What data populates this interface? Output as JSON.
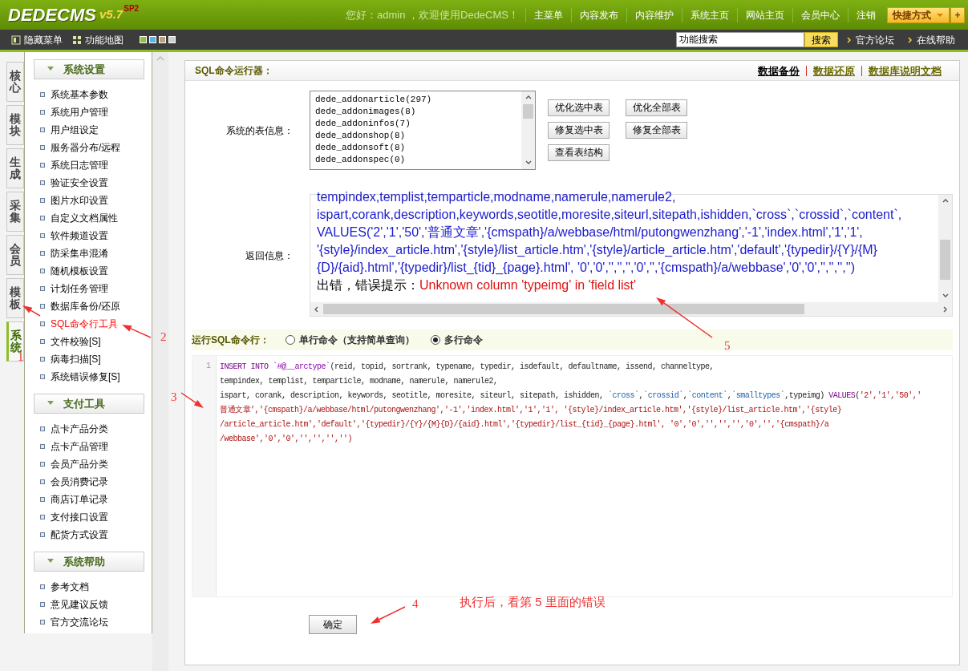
{
  "header": {
    "logo": "DEDECMS",
    "version": "v5.7",
    "edition": "SP2",
    "greeting": "您好：admin ，欢迎使用DedeCMS！",
    "nav": [
      "主菜单",
      "内容发布",
      "内容维护",
      "系统主页",
      "网站主页",
      "会员中心",
      "注销"
    ],
    "shortcut": "快捷方式",
    "add": "+"
  },
  "toolbar": {
    "links": [
      "隐藏菜单",
      "功能地图"
    ],
    "themes": [
      {
        "color": "#8cc43c"
      },
      {
        "color": "#5ab4e6"
      },
      {
        "color": "#b9a27c"
      },
      {
        "color": "#cfcfcf"
      }
    ],
    "search": {
      "value": "功能搜索",
      "button": "搜索"
    },
    "help_links": [
      "官方论坛",
      "在线帮助"
    ]
  },
  "side_tabs": [
    {
      "label": "核心",
      "selected": false
    },
    {
      "label": "模块",
      "selected": false
    },
    {
      "label": "生成",
      "selected": false
    },
    {
      "label": "采集",
      "selected": false
    },
    {
      "label": "会员",
      "selected": false
    },
    {
      "label": "模板",
      "selected": false
    },
    {
      "label": "系统",
      "selected": true
    }
  ],
  "menu_groups": [
    {
      "title": "系统设置",
      "expanded": true,
      "items": [
        {
          "label": "系统基本参数",
          "selected": false
        },
        {
          "label": "系统用户管理",
          "selected": false
        },
        {
          "label": "用户组设定",
          "selected": false
        },
        {
          "label": "服务器分布/远程",
          "selected": false
        },
        {
          "label": "系统日志管理",
          "selected": false
        },
        {
          "label": "验证安全设置",
          "selected": false
        },
        {
          "label": "图片水印设置",
          "selected": false
        },
        {
          "label": "自定义文档属性",
          "selected": false
        },
        {
          "label": "软件频道设置",
          "selected": false
        },
        {
          "label": "防采集串混淆",
          "selected": false
        },
        {
          "label": "随机模板设置",
          "selected": false
        },
        {
          "label": "计划任务管理",
          "selected": false
        },
        {
          "label": "数据库备份/还原",
          "selected": false
        },
        {
          "label": "SQL命令行工具",
          "selected": true
        },
        {
          "label": "文件校验[S]",
          "selected": false
        },
        {
          "label": "病毒扫描[S]",
          "selected": false
        },
        {
          "label": "系统错误修复[S]",
          "selected": false
        }
      ]
    },
    {
      "title": "支付工具",
      "expanded": true,
      "items": [
        {
          "label": "点卡产品分类",
          "selected": false
        },
        {
          "label": "点卡产品管理",
          "selected": false
        },
        {
          "label": "会员产品分类",
          "selected": false
        },
        {
          "label": "会员消费记录",
          "selected": false
        },
        {
          "label": "商店订单记录",
          "selected": false
        },
        {
          "label": "支付接口设置",
          "selected": false
        },
        {
          "label": "配货方式设置",
          "selected": false
        }
      ]
    },
    {
      "title": "系统帮助",
      "expanded": true,
      "items": [
        {
          "label": "参考文档",
          "selected": false
        },
        {
          "label": "意见建议反馈",
          "selected": false
        },
        {
          "label": "官方交流论坛",
          "selected": false
        }
      ]
    }
  ],
  "main": {
    "title": "SQL命令运行器：",
    "links": [
      {
        "label": "数据备份",
        "selected": true
      },
      {
        "label": "数据还原",
        "selected": false
      },
      {
        "label": "数据库说明文档",
        "selected": false
      }
    ],
    "tables": {
      "label": "系统的表信息：",
      "options": [
        "dede_addonarticle(297)",
        "dede_addonimages(8)",
        "dede_addoninfos(7)",
        "dede_addonshop(8)",
        "dede_addonsoft(8)",
        "dede_addonspec(0)"
      ]
    },
    "table_buttons": [
      "优化选中表",
      "优化全部表",
      "修复选中表",
      "修复全部表",
      "查看表结构"
    ],
    "return_info": {
      "label": "返回信息：",
      "lines": [
        "tempindex,templist,temparticle,modname,namerule,namerule2,",
        "ispart,corank,description,keywords,seotitle,moresite,siteurl,sitepath,ishidden,`cross`,`crossid`,`content`,",
        "VALUES('2','1','50','普通文章','{cmspath}/a/webbase/html/putongwenzhang','-1','index.html','1','1',",
        "'{style}/index_article.htm','{style}/list_article.htm','{style}/article_article.htm','default','{typedir}/{Y}/{M}",
        "{D}/{aid}.html','{typedir}/list_{tid}_{page}.html', '0','0','','','','0','','{cmspath}/a/webbase','0','0','','','','')"
      ],
      "message": "出错，错误提示：",
      "error": "Unknown column 'typeimg' in 'field list'"
    },
    "run": {
      "label": "运行SQL命令行：",
      "modes": [
        {
          "label": "单行命令（支持简单查询）",
          "selected": false
        },
        {
          "label": "多行命令",
          "selected": true
        }
      ]
    },
    "editor": {
      "line_numbers": [
        "1"
      ],
      "lines": [
        [
          {
            "kind": "keyword",
            "text": "INSERT INTO "
          },
          {
            "kind": "table",
            "text": "`#@__arctype`"
          },
          {
            "kind": "plain",
            "text": "(reid, topid, sortrank, typename, typedir, isdefault, defaultname, issend, channeltype,"
          }
        ],
        [
          {
            "kind": "plain",
            "text": "tempindex, templist, temparticle, modname, namerule, namerule2,"
          }
        ],
        [
          {
            "kind": "plain",
            "text": "ispart, corank, description, keywords, seotitle, moresite, siteurl, sitepath, ishidden, "
          },
          {
            "kind": "ident",
            "text": "`cross`"
          },
          {
            "kind": "plain",
            "text": ","
          },
          {
            "kind": "ident",
            "text": "`crossid`"
          },
          {
            "kind": "plain",
            "text": ","
          },
          {
            "kind": "ident",
            "text": "`content`"
          },
          {
            "kind": "plain",
            "text": ","
          },
          {
            "kind": "ident",
            "text": "`smalltypes`"
          },
          {
            "kind": "plain",
            "text": ",typeimg) "
          },
          {
            "kind": "keyword",
            "text": "VALUES"
          },
          {
            "kind": "plain",
            "text": "("
          },
          {
            "kind": "string",
            "text": "'2','1','50','"
          }
        ],
        [
          {
            "kind": "string",
            "text": "普通文章','{cmspath}/a/webbase/html/putongwenzhang','-1','index.html','1','1', '{style}/index_article.htm','{style}/list_article.htm','{style}"
          }
        ],
        [
          {
            "kind": "string",
            "text": "/article_article.htm','default','{typedir}/{Y}/{M}{D}/{aid}.html','{typedir}/list_{tid}_{page}.html', '0','0','','','','0','','{cmspath}/a"
          }
        ],
        [
          {
            "kind": "string",
            "text": "/webbase','0','0','','','','')"
          }
        ]
      ]
    },
    "submit": "确定"
  },
  "annotations": [
    {
      "kind": "marker",
      "label": "1"
    },
    {
      "kind": "marker",
      "label": "2"
    },
    {
      "kind": "marker",
      "label": "3"
    },
    {
      "kind": "marker",
      "label": "4"
    },
    {
      "kind": "marker",
      "label": "5"
    },
    {
      "kind": "note",
      "label": "执行后，看第 5 里面的错误"
    }
  ]
}
